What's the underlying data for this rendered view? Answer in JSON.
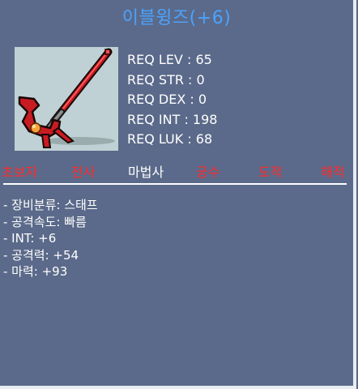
{
  "item": {
    "title": "이블윙즈(+6)",
    "icon": "red-staff-icon"
  },
  "requirements": [
    {
      "label": "REQ LEV",
      "value": "65",
      "text": "REQ LEV : 65"
    },
    {
      "label": "REQ STR",
      "value": "0",
      "text": "REQ STR : 0"
    },
    {
      "label": "REQ DEX",
      "value": "0",
      "text": "REQ DEX : 0"
    },
    {
      "label": "REQ INT",
      "value": "198",
      "text": "REQ INT : 198"
    },
    {
      "label": "REQ LUK",
      "value": "68",
      "text": "REQ LUK : 68"
    }
  ],
  "jobs": [
    {
      "label": "초보자",
      "allowed": false
    },
    {
      "label": "전사",
      "allowed": false
    },
    {
      "label": "마법사",
      "allowed": true
    },
    {
      "label": "궁수",
      "allowed": false
    },
    {
      "label": "도적",
      "allowed": false
    },
    {
      "label": "해적",
      "allowed": false
    }
  ],
  "stats": [
    "- 장비분류: 스태프",
    "- 공격속도: 빠름",
    "- INT: +6",
    "- 공격력: +54",
    "- 마력: +93"
  ],
  "colors": {
    "background": "#5b6a8a",
    "title": "#4aa3ff",
    "allowed_job": "#ffffff",
    "restricted_job": "#ff2a2a",
    "icon_background": "#bfd1d4"
  }
}
